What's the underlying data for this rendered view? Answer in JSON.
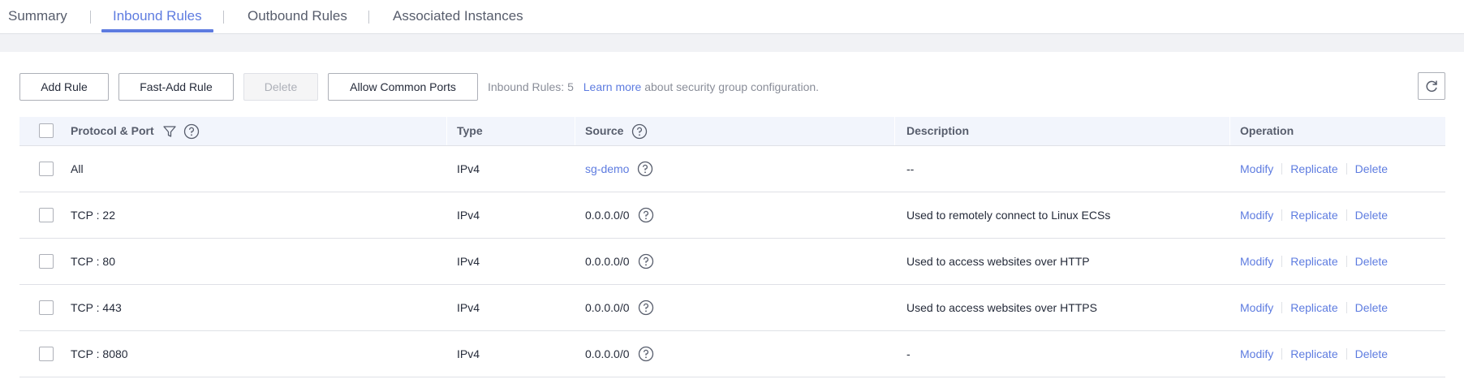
{
  "tabs": [
    {
      "label": "Summary",
      "active": false
    },
    {
      "label": "Inbound Rules",
      "active": true
    },
    {
      "label": "Outbound Rules",
      "active": false
    },
    {
      "label": "Associated Instances",
      "active": false
    }
  ],
  "toolbar": {
    "add_rule": "Add Rule",
    "fast_add_rule": "Fast-Add Rule",
    "delete": "Delete",
    "allow_common_ports": "Allow Common Ports",
    "rule_count_text": "Inbound Rules: 5",
    "learn_more": "Learn more",
    "info_suffix": "about security group configuration.",
    "refresh_icon": "refresh-icon"
  },
  "table": {
    "headers": {
      "protocol_port": "Protocol & Port",
      "type": "Type",
      "source": "Source",
      "description": "Description",
      "operation": "Operation"
    },
    "rows": [
      {
        "protocol_port": "All",
        "type": "IPv4",
        "source": "sg-demo",
        "source_is_link": true,
        "description": "--",
        "ops": [
          "Modify",
          "Replicate",
          "Delete"
        ]
      },
      {
        "protocol_port": "TCP : 22",
        "type": "IPv4",
        "source": "0.0.0.0/0",
        "source_is_link": false,
        "description": "Used to remotely connect to Linux ECSs",
        "ops": [
          "Modify",
          "Replicate",
          "Delete"
        ]
      },
      {
        "protocol_port": "TCP : 80",
        "type": "IPv4",
        "source": "0.0.0.0/0",
        "source_is_link": false,
        "description": "Used to access websites over HTTP",
        "ops": [
          "Modify",
          "Replicate",
          "Delete"
        ]
      },
      {
        "protocol_port": "TCP : 443",
        "type": "IPv4",
        "source": "0.0.0.0/0",
        "source_is_link": false,
        "description": "Used to access websites over HTTPS",
        "ops": [
          "Modify",
          "Replicate",
          "Delete"
        ]
      },
      {
        "protocol_port": "TCP : 8080",
        "type": "IPv4",
        "source": "0.0.0.0/0",
        "source_is_link": false,
        "description": "-",
        "ops": [
          "Modify",
          "Replicate",
          "Delete"
        ]
      }
    ]
  },
  "colors": {
    "accent": "#5e7ce0",
    "header_bg": "#f2f5fc",
    "band_bg": "#f1f2f5",
    "text": "#252b3a",
    "muted": "#8a8e99"
  }
}
